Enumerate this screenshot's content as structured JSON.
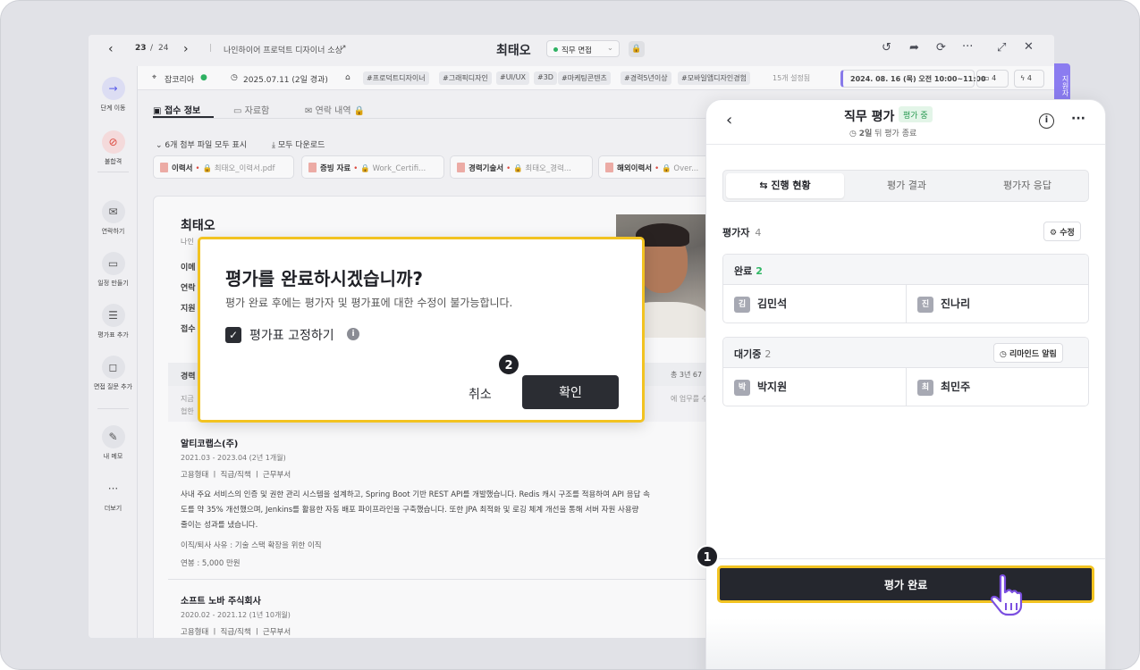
{
  "topbar": {
    "page_current": "23",
    "page_sep": "/",
    "page_total": "24",
    "job_title": "나인하이어 프로덕트 디자이너 소싱",
    "candidate": "최태오",
    "stage": "직무 면접"
  },
  "infobar": {
    "source": "잡코리아",
    "applied": "2025.07.11 (2일 경과)",
    "tags": [
      "#프로덕트디자이너",
      "#그래픽디자인",
      "#UI/UX",
      "#3D",
      "#마케팅콘텐츠",
      "#경력5년이상",
      "#모바일앱디자인경험"
    ],
    "tags_more": "15개 설정됨",
    "schedule": "2024. 08. 16 (목) 오전 10:00~11:00",
    "cal_count": "4",
    "bolt_count": "4"
  },
  "sidebar": [
    {
      "label": "단계 이동",
      "icon": "→"
    },
    {
      "label": "불합격",
      "icon": "⊘"
    },
    {
      "label": "연락하기",
      "icon": "✉"
    },
    {
      "label": "일정 만들기",
      "icon": "▭"
    },
    {
      "label": "평가표 추가",
      "icon": "☰"
    },
    {
      "label": "면접 질문 추가",
      "icon": "◻"
    },
    {
      "label": "내 메모",
      "icon": "✎"
    },
    {
      "label": "더보기",
      "icon": "···"
    }
  ],
  "tabs": [
    "접수 정보",
    "자료함",
    "연락 내역"
  ],
  "files": {
    "show_all": "6개 첨부 파일 모두 표시",
    "download_all": "모두 다운로드",
    "chips": [
      {
        "label": "이력서",
        "file": "최태오_이력서.pdf"
      },
      {
        "label": "증빙 자료",
        "file": "Work_Certifi..."
      },
      {
        "label": "경력기술서",
        "file": "최태오_경력..."
      },
      {
        "label": "해외이력서",
        "file": "Over..."
      }
    ]
  },
  "profile": {
    "name": "최태오",
    "sub": "나인",
    "f1": "이메",
    "f2": "연락",
    "f3": "지원",
    "f4": "접수",
    "career": "경력",
    "career_total": "총 3년 67",
    "career_note1": "지금",
    "career_note2": "협한",
    "career_note_r": "에 업무를 수행하여"
  },
  "jobs": [
    {
      "company": "알티코랩스(주)",
      "period": "2021.03 - 2023.04 (2년 1개월)",
      "meta": "고용형태 ㅣ 직급/직책 ㅣ 근무부서",
      "desc1": "사내 주요 서비스의 인증 및 권한 관리 시스템을 설계하고, Spring Boot 기반 REST API를 개발했습니다. Redis 캐시 구조를 적용하여 API 응답 속",
      "desc2": "도를 약 35% 개선했으며, Jenkins를 활용한 자동 배포 파이프라인을 구축했습니다. 또한 JPA 최적화 및 로깅 체계 개선을 통해 서버 자원 사용량",
      "desc3": "줄이는 성과를 냈습니다.",
      "reason": "이직/퇴사 사유 : 기술 스택 확장을 위한 이직",
      "salary": "연봉 : 5,000 만원"
    },
    {
      "company": "소프트 노바 주식회사",
      "period": "2020.02 - 2021.12 (1년 10개월)",
      "meta": "고용형태 ㅣ 직급/직책 ㅣ 근무부서"
    }
  ],
  "modal": {
    "title": "평가를 완료하시겠습니까?",
    "desc": "평가 완료 후에는 평가자 및 평가표에 대한 수정이 불가능합니다.",
    "checkbox": "평가표 고정하기",
    "cancel": "취소",
    "confirm": "확인"
  },
  "badges": {
    "one": "1",
    "two": "2"
  },
  "panel": {
    "title": "직무 평가",
    "status": "평가 중",
    "sub_bold": "2일",
    "sub_rest": " 뒤 평가 종료",
    "tabs": [
      "진행 현황",
      "평가 결과",
      "평가자 응답"
    ],
    "evaluators_label": "평가자",
    "evaluators_count": "4",
    "edit": "수정",
    "done_label": "완료",
    "done_count": "2",
    "done": [
      {
        "initial": "김",
        "name": "김민석"
      },
      {
        "initial": "진",
        "name": "진나리"
      }
    ],
    "wait_label": "대기중",
    "wait_count": "2",
    "remind": "리마인드 알림",
    "wait": [
      {
        "initial": "박",
        "name": "박지원"
      },
      {
        "initial": "최",
        "name": "최민주"
      }
    ],
    "complete_btn": "평가 완료",
    "side_tab": "지원자"
  },
  "colors": {
    "accent_highlight": "#f2c321",
    "primary_dark": "#25272e",
    "success": "#2fb664"
  }
}
